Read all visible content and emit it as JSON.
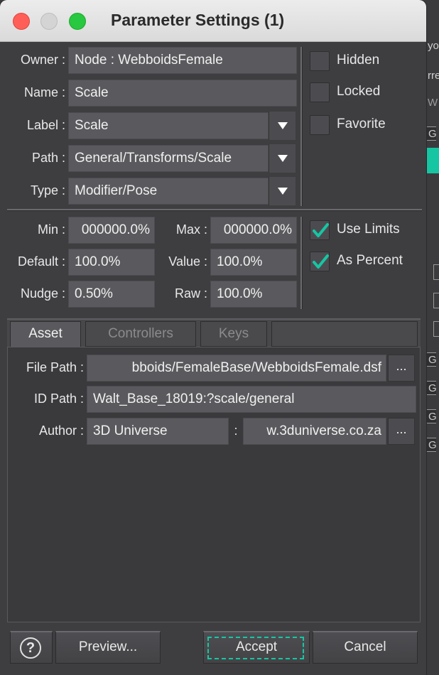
{
  "window": {
    "title": "Parameter Settings (1)"
  },
  "backdrop": {
    "snippets": [
      "yo",
      "rre",
      "W"
    ]
  },
  "properties": {
    "owner": {
      "label": "Owner :",
      "value": "Node : WebboidsFemale"
    },
    "name": {
      "label": "Name :",
      "value": "Scale"
    },
    "label": {
      "label": "Label :",
      "value": "Scale"
    },
    "path": {
      "label": "Path :",
      "value": "General/Transforms/Scale"
    },
    "type": {
      "label": "Type :",
      "value": "Modifier/Pose"
    }
  },
  "flags": {
    "hidden": {
      "label": "Hidden",
      "checked": false
    },
    "locked": {
      "label": "Locked",
      "checked": false
    },
    "favorite": {
      "label": "Favorite",
      "checked": false
    }
  },
  "limits": {
    "min": {
      "label": "Min :",
      "value": "000000.0%"
    },
    "max": {
      "label": "Max :",
      "value": "000000.0%"
    },
    "default": {
      "label": "Default :",
      "value": "100.0%"
    },
    "value": {
      "label": "Value :",
      "value": "100.0%"
    },
    "nudge": {
      "label": "Nudge :",
      "value": "0.50%"
    },
    "raw": {
      "label": "Raw :",
      "value": "100.0%"
    },
    "use_limits": {
      "label": "Use Limits",
      "checked": true
    },
    "as_percent": {
      "label": "As Percent",
      "checked": true
    }
  },
  "tabs": [
    {
      "label": "Asset",
      "active": true
    },
    {
      "label": "Controllers",
      "active": false
    },
    {
      "label": "Keys",
      "active": false
    }
  ],
  "asset": {
    "file_path": {
      "label": "File Path :",
      "value": "bboids/FemaleBase/WebboidsFemale.dsf"
    },
    "id_path": {
      "label": "ID Path :",
      "value": "Walt_Base_18019:?scale/general"
    },
    "author": {
      "label": "Author :",
      "value": "3D Universe",
      "sep": ":",
      "url": "w.3duniverse.co.za"
    },
    "ellipsis": "..."
  },
  "footer": {
    "help": "?",
    "preview": "Preview...",
    "accept": "Accept",
    "cancel": "Cancel"
  },
  "colors": {
    "accent": "#16c6a3",
    "panel": "#3e3e41",
    "field": "#5a5a5e"
  }
}
